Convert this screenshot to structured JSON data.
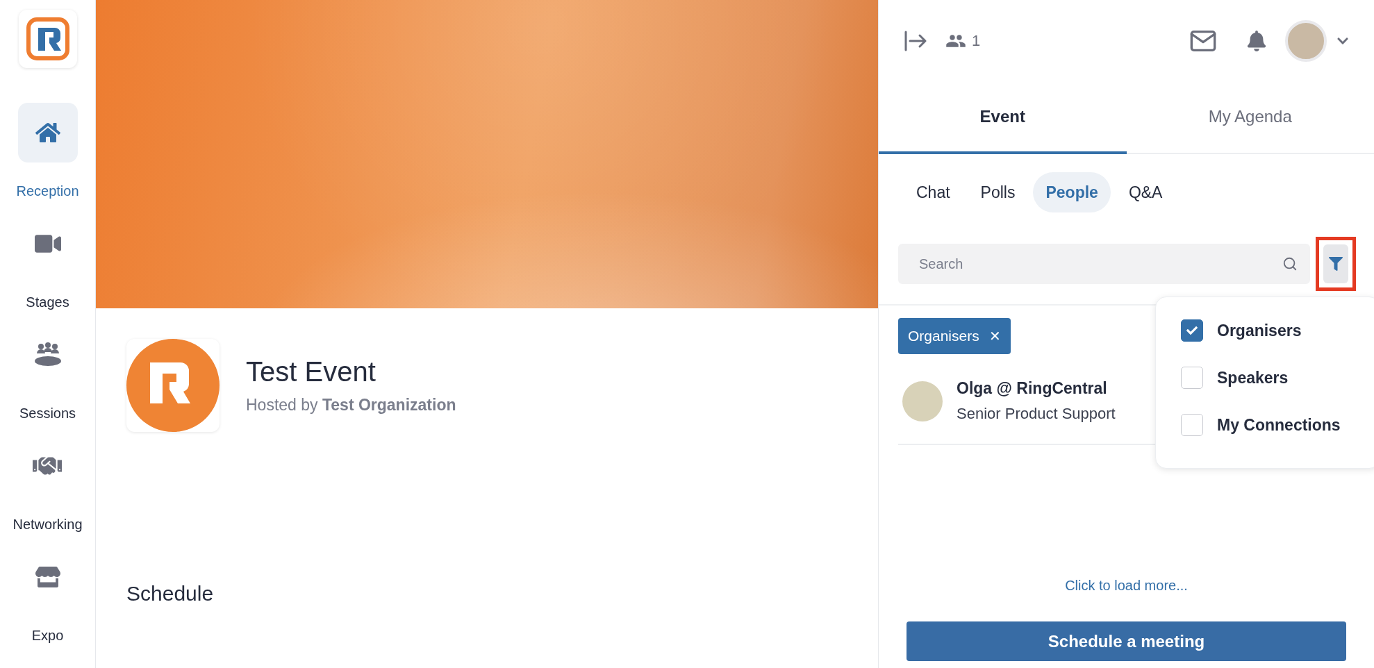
{
  "sidebar": {
    "items": [
      {
        "label": "Reception",
        "kind": "home",
        "selected": true
      },
      {
        "label": "Stages",
        "kind": "video",
        "selected": false
      },
      {
        "label": "Sessions",
        "kind": "sessions",
        "selected": false
      },
      {
        "label": "Networking",
        "kind": "handshake",
        "selected": false
      },
      {
        "label": "Expo",
        "kind": "store",
        "selected": false
      }
    ]
  },
  "event": {
    "title": "Test Event",
    "hosted_by": "Hosted by **Test Organization**"
  },
  "schedule_heading": "Schedule",
  "header": {
    "participant_count": "1"
  },
  "main_tabs": [
    {
      "label": "Event",
      "selected": true
    },
    {
      "label": "My Agenda",
      "selected": false
    }
  ],
  "sub_tabs": [
    {
      "label": "Chat",
      "selected": false
    },
    {
      "label": "Polls",
      "selected": false
    },
    {
      "label": "People",
      "selected": true
    },
    {
      "label": "Q&A",
      "selected": false
    }
  ],
  "search": {
    "placeholder": "Search"
  },
  "filter_chips": [
    {
      "label": "Organisers",
      "remove": "✕"
    }
  ],
  "people": [
    {
      "name": "Olga @ RingCentral",
      "title": "Senior Product Support"
    }
  ],
  "filter_menu": [
    {
      "label": "Organisers",
      "checked": true
    },
    {
      "label": "Speakers",
      "checked": false
    },
    {
      "label": "My Connections",
      "checked": false
    }
  ],
  "load_more": "Click to load more...",
  "schedule_button": "Schedule a meeting"
}
